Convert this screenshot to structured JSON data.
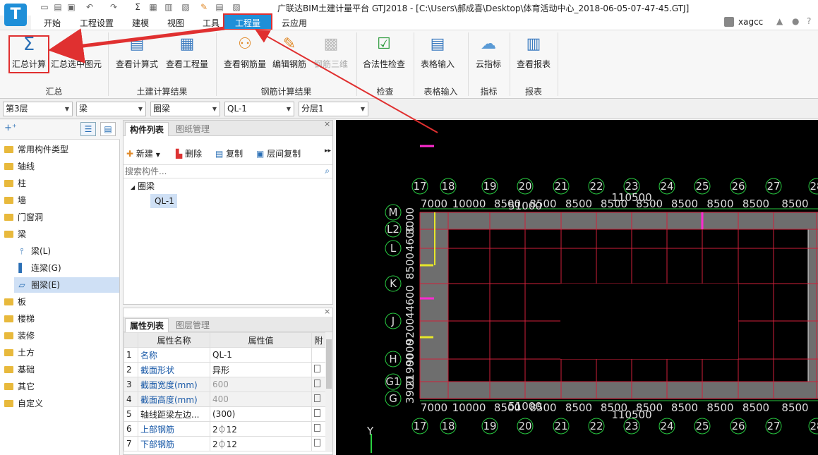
{
  "app": {
    "title": "广联达BIM土建计量平台 GTJ2018 - [C:\\Users\\郝成喜\\Desktop\\体育活动中心_2018-06-05-07-47-45.GTJ]",
    "user": "xagcc",
    "icon_letter": "T"
  },
  "menu": [
    "开始",
    "工程设置",
    "建模",
    "视图",
    "工具",
    "工程量",
    "云应用"
  ],
  "ribbon": {
    "buttons": [
      "汇总计算",
      "汇总选中图元",
      "查看计算式",
      "查看工程量",
      "查看钢筋量",
      "编辑钢筋",
      "钢筋三维",
      "合法性检查",
      "表格输入",
      "云指标",
      "查看报表"
    ],
    "groups": [
      "汇总",
      "土建计算结果",
      "钢筋计算结果",
      "检查",
      "表格输入",
      "指标",
      "报表"
    ]
  },
  "filters": [
    "第3层",
    "梁",
    "圈梁",
    "QL-1",
    "分层1"
  ],
  "tree": [
    "常用构件类型",
    "轴线",
    "柱",
    "墙",
    "门窗洞",
    "梁",
    "梁(L)",
    "连梁(G)",
    "圈梁(E)",
    "板",
    "楼梯",
    "装修",
    "土方",
    "基础",
    "其它",
    "自定义"
  ],
  "component_panel": {
    "tabs": [
      "构件列表",
      "图纸管理"
    ],
    "toolbar": [
      "新建",
      "删除",
      "复制",
      "层间复制"
    ],
    "search_placeholder": "搜索构件...",
    "group": "圈梁",
    "item": "QL-1"
  },
  "property_panel": {
    "tabs": [
      "属性列表",
      "图层管理"
    ],
    "headers": [
      "属性名称",
      "属性值",
      "附"
    ],
    "rows": [
      {
        "no": "1",
        "name": "名称",
        "value": "QL-1"
      },
      {
        "no": "2",
        "name": "截面形状",
        "value": "异形"
      },
      {
        "no": "3",
        "name": "截面宽度(mm)",
        "value": "600"
      },
      {
        "no": "4",
        "name": "截面高度(mm)",
        "value": "400"
      },
      {
        "no": "5",
        "name": "轴线距梁左边...",
        "value": "(300)"
      },
      {
        "no": "6",
        "name": "上部钢筋",
        "value": "2⏀12"
      },
      {
        "no": "7",
        "name": "下部钢筋",
        "value": "2⏀12"
      }
    ]
  },
  "drawing": {
    "axes_x": [
      "17",
      "18",
      "19",
      "20",
      "21",
      "22",
      "23",
      "24",
      "25",
      "26",
      "27",
      "28"
    ],
    "axes_y": [
      "M",
      "L2",
      "L",
      "K",
      "J",
      "H",
      "G1",
      "G"
    ],
    "dims_x": [
      "7000",
      "10000",
      "8500",
      "8500",
      "8500",
      "8500",
      "8500",
      "8500",
      "8500",
      "8500",
      "8500"
    ],
    "total_top": "110500",
    "sub_top": "51000",
    "dims_y_left": [
      "3000",
      "4600",
      "8500",
      "44600",
      "9200",
      "9000",
      "21900",
      "3900"
    ],
    "axis_label_y": "Y",
    "colors": {
      "bg": "#000000",
      "gridline": "#d0203a",
      "beam": "#6e6e6e",
      "axis_bubble": "#28c840",
      "dim": "#28c840",
      "mark_magenta": "#ff2bd0",
      "mark_yellow": "#e6e62a"
    }
  },
  "highlight_color": "#e03030"
}
